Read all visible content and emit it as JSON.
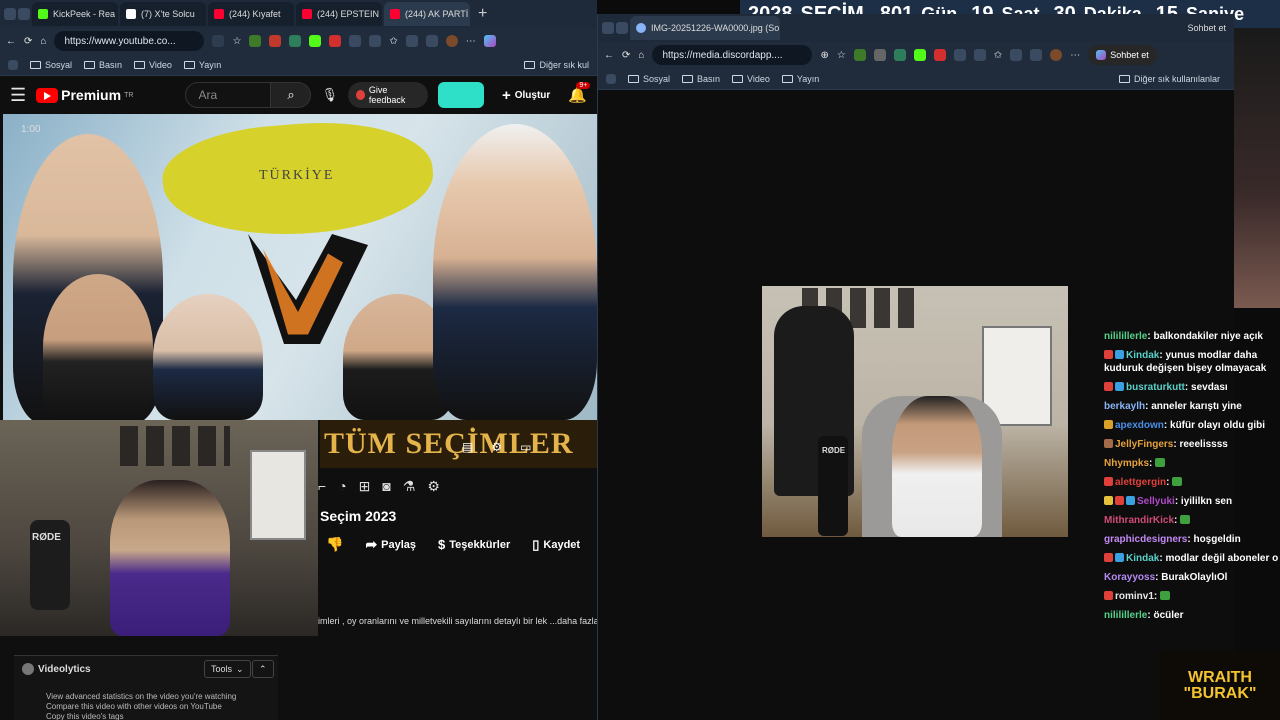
{
  "left_browser": {
    "tabs": [
      {
        "label": "KickPeek - Rea",
        "color": "#53fc18"
      },
      {
        "label": "(7) X'te Solcu",
        "color": "#ffffff"
      },
      {
        "label": "(244) Kıyafet",
        "color": "#ff0033"
      },
      {
        "label": "(244) EPSTEIN",
        "color": "#ff0033"
      },
      {
        "label": "(244) AK PARTİ",
        "color": "#ff0033"
      }
    ],
    "url": "https://www.youtube.co...",
    "bookmarks": [
      "Sosyal",
      "Basın",
      "Video",
      "Yayın"
    ],
    "other_bookmarks": "Diğer sık kul"
  },
  "youtube": {
    "logo_text": "Premium",
    "logo_sup": "TR",
    "search_placeholder": "Ara",
    "feedback_label": "Give feedback",
    "create_label": "Oluştur",
    "notif_count": "9+",
    "banner_text": "TÜM SEÇİMLER",
    "video_title": "Seçim 2023",
    "actions": {
      "share": "Paylaş",
      "thanks": "Teşekkürler",
      "save": "Kaydet"
    },
    "description": "imleri , oy oranlarını ve milletvekili sayılarını detaylı bir lek  ...daha fazla",
    "time_badge": "1:00"
  },
  "extension": {
    "title": "Videolytics",
    "tools_label": "Tools",
    "text_1": "View advanced statistics on the video you're watching",
    "text_2": "Compare this video with other videos on YouTube",
    "text_3": "Copy this video's tags"
  },
  "right_browser": {
    "tab_label": "IMG-20251226-WA0000.jpg (So",
    "url": "https://media.discordapp....",
    "bookmarks": [
      "Sosyal",
      "Basın",
      "Video",
      "Yayın"
    ],
    "other_bookmarks": "Diğer sık kullanılanlar",
    "copilot_label": "Sohbet et",
    "copilot_label_2": "Sohbet et",
    "other_bookmarks_2": "Diğer sık kullanılanlar"
  },
  "countdown": {
    "year": "2028",
    "label": "SEÇİM",
    "days": "801",
    "days_label": "Gün",
    "hours": "19",
    "hours_label": "Saat",
    "minutes": "30",
    "minutes_label": "Dakika",
    "seconds": "15",
    "seconds_label": "Saniye"
  },
  "chat": [
    {
      "user": "nililillerle",
      "color": "#55d28a",
      "text": "balkondakiler niye açık",
      "badges": []
    },
    {
      "user": "Kindak",
      "color": "#5ad1c9",
      "text": "yunus modlar daha kuduruk değişen bişey olmayacak",
      "badges": [
        "#e0403a",
        "#3aa0e0"
      ]
    },
    {
      "user": "busraturkutt",
      "color": "#5ad1c9",
      "text": "sevdası",
      "badges": [
        "#e0403a",
        "#3aa0e0"
      ]
    },
    {
      "user": "berkaylh",
      "color": "#8ab4f8",
      "text": "anneler karıştı yine",
      "badges": []
    },
    {
      "user": "apexdown",
      "color": "#4a8fe8",
      "text": "küfür olayı oldu gibi",
      "badges": [
        "#d8a12a"
      ]
    },
    {
      "user": "JellyFingers",
      "color": "#e6a23c",
      "text": "reeelissss",
      "badges": [
        "#a36b4a"
      ]
    },
    {
      "user": "Nhympks",
      "color": "#e6a23c",
      "text": "",
      "badges": [],
      "emote": true
    },
    {
      "user": "alettgergin",
      "color": "#e0403a",
      "text": "",
      "badges": [
        "#e0403a"
      ],
      "emote": true
    },
    {
      "user": "Sellyuki",
      "color": "#b04ac8",
      "text": "iyililkn sen",
      "badges": [
        "#e6c23c",
        "#e0403a",
        "#3aa0e0"
      ]
    },
    {
      "user": "MithrandirKick",
      "color": "#d14a7a",
      "text": "",
      "badges": [],
      "emote": true
    },
    {
      "user": "graphicdesigners",
      "color": "#c489f5",
      "text": "hoşgeldin",
      "badges": []
    },
    {
      "user": "Kindak",
      "color": "#5ad1c9",
      "text": "modlar değil aboneler o",
      "badges": [
        "#e0403a",
        "#3aa0e0"
      ]
    },
    {
      "user": "Korayyoss",
      "color": "#b48af5",
      "text": "BurakOlaylıOl",
      "badges": []
    },
    {
      "user": "rominv1",
      "color": "#e6e6e6",
      "text": "",
      "badges": [
        "#e0403a"
      ],
      "emote": true
    },
    {
      "user": "nililillerle",
      "color": "#55d28a",
      "text": "öcüler",
      "badges": []
    }
  ],
  "brand": {
    "line1": "WRAITH",
    "line2": "\"BURAK\""
  }
}
